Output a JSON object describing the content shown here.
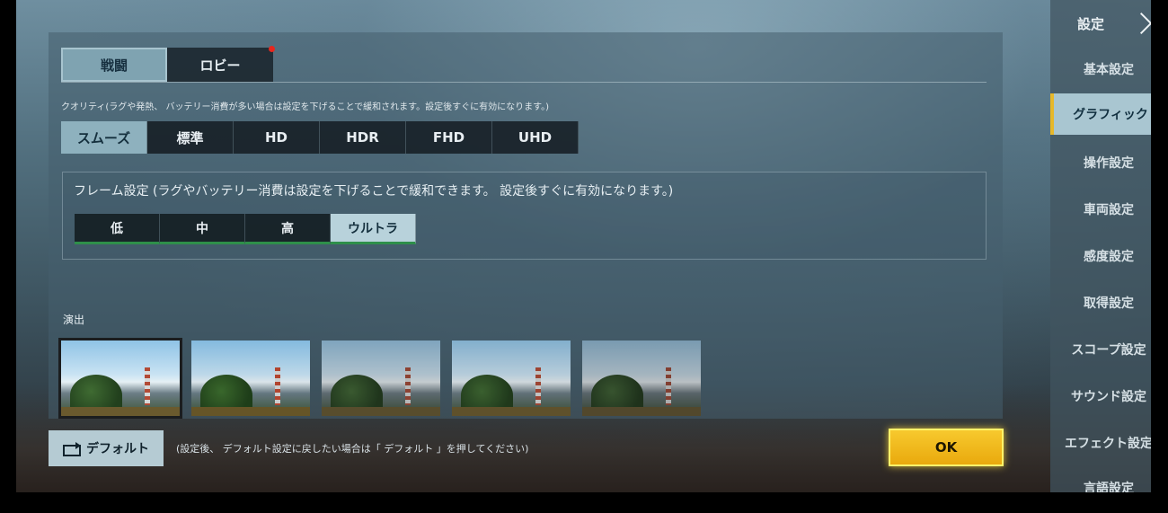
{
  "top_tabs": [
    {
      "label": "戦闘",
      "active": true
    },
    {
      "label": "ロビー",
      "active": false,
      "badge": true
    }
  ],
  "quality": {
    "label": "クオリティ(ラグや発熱、 バッテリー消費が多い場合は設定を下げることで緩和されます。設定後すぐに有効になります。)",
    "options": [
      "スムーズ",
      "標準",
      "HD",
      "HDR",
      "FHD",
      "UHD"
    ],
    "selected": "スムーズ"
  },
  "frame": {
    "label": "フレーム設定 (ラグやバッテリー消費は設定を下げることで緩和できます。 設定後すぐに有効になります。)",
    "options": [
      "低",
      "中",
      "高",
      "ウルトラ"
    ],
    "selected": "ウルトラ"
  },
  "effect": {
    "label": "演出",
    "selected_index": 0
  },
  "bottom": {
    "default_label": "デフォルト",
    "default_note": "(設定後、 デフォルト設定に戻したい場合は「 デフォルト 」を押してください)",
    "ok_label": "OK"
  },
  "sidebar": {
    "title": "設定",
    "items": [
      {
        "label": "基本設定",
        "badge": true
      },
      {
        "label": "グラフィック",
        "active": true,
        "badge": true
      },
      {
        "label": "操作設定",
        "badge": true
      },
      {
        "label": "車両設定"
      },
      {
        "label": "感度設定",
        "badge": true
      },
      {
        "label": "取得設定"
      },
      {
        "label": "スコープ設定",
        "badge": true
      },
      {
        "label": "サウンド設定"
      },
      {
        "label": "エフェクト設定",
        "badge": true
      },
      {
        "label": "言語設定"
      }
    ]
  },
  "colors": {
    "accent_yellow": "#f2be22",
    "badge_red": "#e8261d",
    "active_tab": "#8eb1be",
    "frame_underline": "#2e8f4a"
  }
}
